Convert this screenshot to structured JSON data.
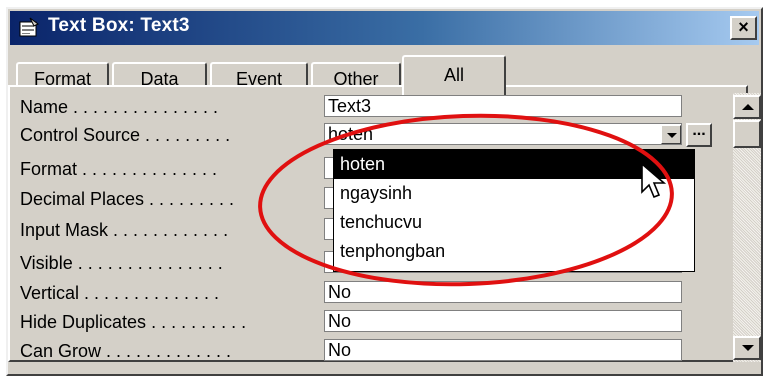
{
  "window": {
    "title": "Text Box: Text3",
    "close_label": "×",
    "title_icon": "properties-sheet-icon"
  },
  "tabs": [
    {
      "label": "Format",
      "active": false
    },
    {
      "label": "Data",
      "active": false
    },
    {
      "label": "Event",
      "active": false
    },
    {
      "label": "Other",
      "active": false
    },
    {
      "label": "All",
      "active": true
    }
  ],
  "properties": [
    {
      "label": "Name . . . . . . . . . . . . . . .",
      "value": "Text3"
    },
    {
      "label": "Control Source . . . . . . . . .",
      "value": "hoten"
    },
    {
      "label": "Format . . . . . . . . . . . . . .",
      "value": ""
    },
    {
      "label": "Decimal Places . . . . . . . . .",
      "value": ""
    },
    {
      "label": "Input Mask . . . . . . . . . . . .",
      "value": ""
    },
    {
      "label": "Visible . . . . . . . . . . . . . . .",
      "value": ""
    },
    {
      "label": "Vertical . . . . . . . . . . . . . .",
      "value": "No"
    },
    {
      "label": "Hide Duplicates . . . . . . . . . .",
      "value": "No"
    },
    {
      "label": "Can Grow . . . . . . . . . . . . .",
      "value": "No"
    }
  ],
  "builder_button_label": "...",
  "dropdown": {
    "options": [
      "hoten",
      "ngaysinh",
      "tenchucvu",
      "tenphongban"
    ],
    "selected": "hoten"
  },
  "colors": {
    "titlebar_start": "#0a246a",
    "titlebar_end": "#a6caf0",
    "annotation": "#e01010",
    "face": "#d4d0c8"
  }
}
